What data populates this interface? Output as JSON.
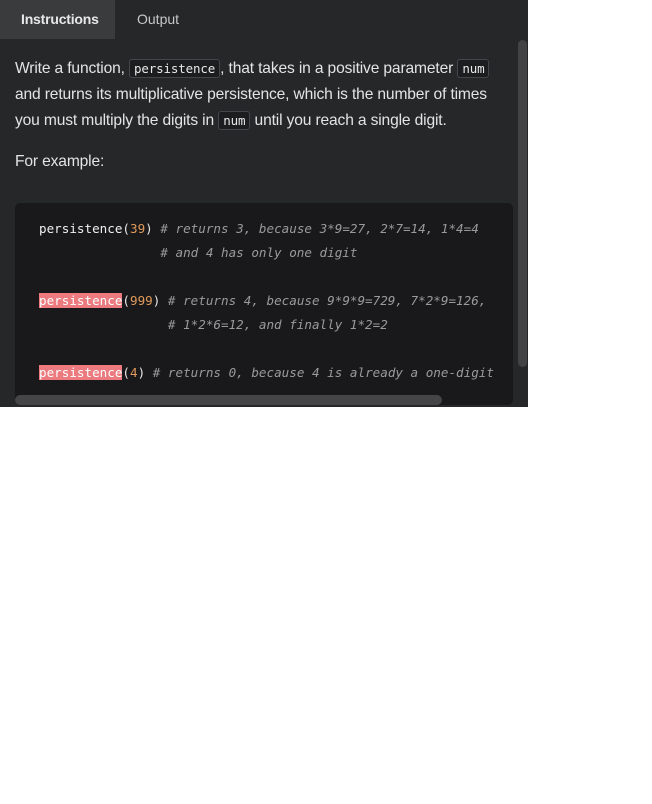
{
  "tabs": [
    {
      "label": "Instructions",
      "active": true
    },
    {
      "label": "Output",
      "active": false
    }
  ],
  "instructions": {
    "para1": {
      "t1": "Write a function, ",
      "code1": "persistence",
      "t2": ", that takes in a positive parameter ",
      "code2": "num",
      "t3": " and returns its multiplicative persistence, which is the number of times you must multiply the digits in ",
      "code3": "num",
      "t4": " until you reach a single digit."
    },
    "para2": "For example:"
  },
  "code_example": {
    "lines": [
      {
        "fn": "persistence",
        "open": "(",
        "arg": "39",
        "close": ")",
        "comment": " # returns 3, because 3*9=27, 2*7=14, 1*4=4",
        "error": false
      },
      {
        "indent": "                ",
        "comment": "# and 4 has only one digit"
      },
      {
        "blank": true
      },
      {
        "fn": "persistence",
        "open": "(",
        "arg": "999",
        "close": ")",
        "comment": " # returns 4, because 9*9*9=729, 7*2*9=126,",
        "error": true
      },
      {
        "indent": "                 ",
        "comment": "# 1*2*6=12, and finally 1*2=2"
      },
      {
        "blank": true
      },
      {
        "fn": "persistence",
        "open": "(",
        "arg": "4",
        "close": ")",
        "comment": " # returns 0, because 4 is already a one-digit",
        "error": true
      }
    ]
  },
  "colors": {
    "panel_bg": "#262729",
    "code_bg": "#19191b",
    "number": "#e09a5c",
    "comment": "#9a9a9a",
    "error_highlight": "#ec7a7e"
  }
}
